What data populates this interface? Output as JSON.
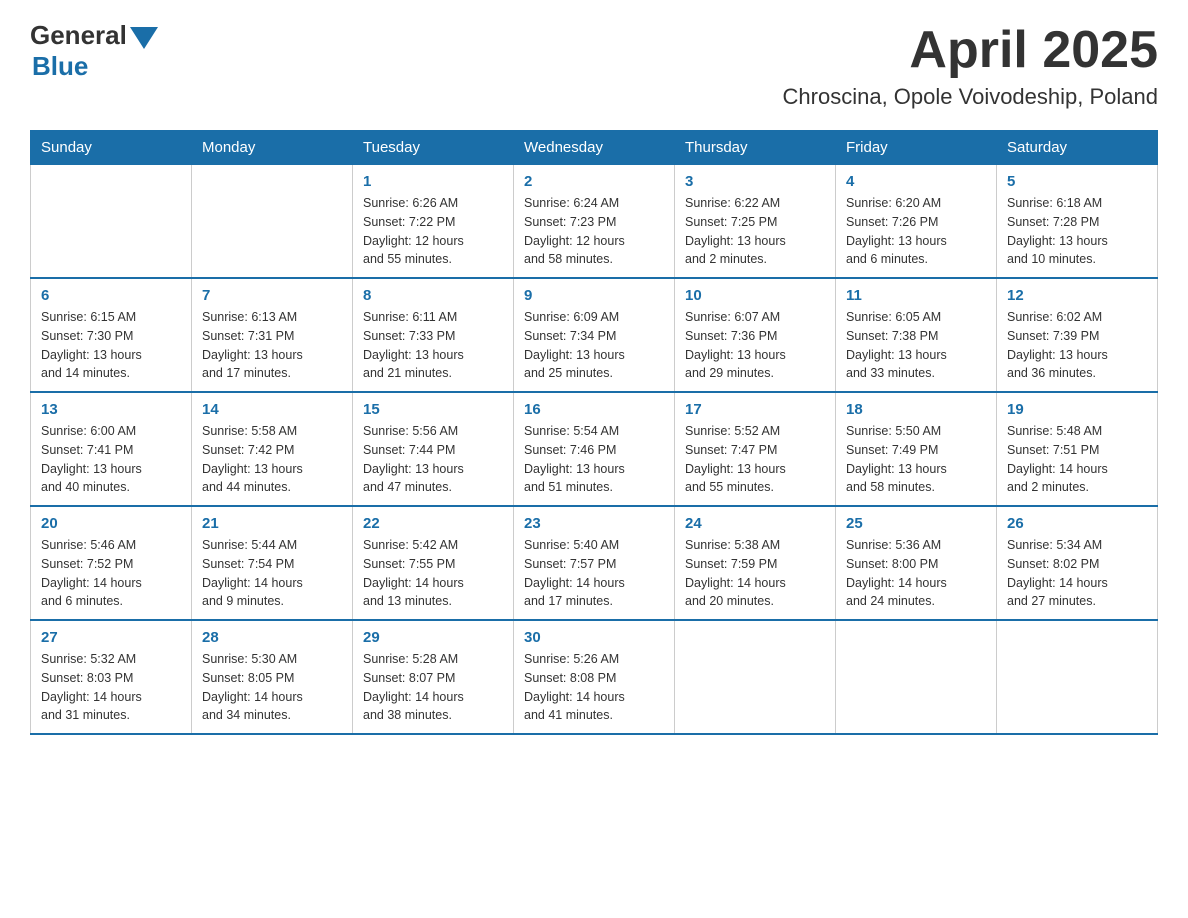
{
  "logo": {
    "general": "General",
    "blue": "Blue"
  },
  "header": {
    "month": "April 2025",
    "location": "Chroscina, Opole Voivodeship, Poland"
  },
  "weekdays": [
    "Sunday",
    "Monday",
    "Tuesday",
    "Wednesday",
    "Thursday",
    "Friday",
    "Saturday"
  ],
  "weeks": [
    [
      {
        "day": "",
        "sunrise": "",
        "sunset": "",
        "daylight": ""
      },
      {
        "day": "",
        "sunrise": "",
        "sunset": "",
        "daylight": ""
      },
      {
        "day": "1",
        "sunrise": "Sunrise: 6:26 AM",
        "sunset": "Sunset: 7:22 PM",
        "daylight": "Daylight: 12 hours and 55 minutes."
      },
      {
        "day": "2",
        "sunrise": "Sunrise: 6:24 AM",
        "sunset": "Sunset: 7:23 PM",
        "daylight": "Daylight: 12 hours and 58 minutes."
      },
      {
        "day": "3",
        "sunrise": "Sunrise: 6:22 AM",
        "sunset": "Sunset: 7:25 PM",
        "daylight": "Daylight: 13 hours and 2 minutes."
      },
      {
        "day": "4",
        "sunrise": "Sunrise: 6:20 AM",
        "sunset": "Sunset: 7:26 PM",
        "daylight": "Daylight: 13 hours and 6 minutes."
      },
      {
        "day": "5",
        "sunrise": "Sunrise: 6:18 AM",
        "sunset": "Sunset: 7:28 PM",
        "daylight": "Daylight: 13 hours and 10 minutes."
      }
    ],
    [
      {
        "day": "6",
        "sunrise": "Sunrise: 6:15 AM",
        "sunset": "Sunset: 7:30 PM",
        "daylight": "Daylight: 13 hours and 14 minutes."
      },
      {
        "day": "7",
        "sunrise": "Sunrise: 6:13 AM",
        "sunset": "Sunset: 7:31 PM",
        "daylight": "Daylight: 13 hours and 17 minutes."
      },
      {
        "day": "8",
        "sunrise": "Sunrise: 6:11 AM",
        "sunset": "Sunset: 7:33 PM",
        "daylight": "Daylight: 13 hours and 21 minutes."
      },
      {
        "day": "9",
        "sunrise": "Sunrise: 6:09 AM",
        "sunset": "Sunset: 7:34 PM",
        "daylight": "Daylight: 13 hours and 25 minutes."
      },
      {
        "day": "10",
        "sunrise": "Sunrise: 6:07 AM",
        "sunset": "Sunset: 7:36 PM",
        "daylight": "Daylight: 13 hours and 29 minutes."
      },
      {
        "day": "11",
        "sunrise": "Sunrise: 6:05 AM",
        "sunset": "Sunset: 7:38 PM",
        "daylight": "Daylight: 13 hours and 33 minutes."
      },
      {
        "day": "12",
        "sunrise": "Sunrise: 6:02 AM",
        "sunset": "Sunset: 7:39 PM",
        "daylight": "Daylight: 13 hours and 36 minutes."
      }
    ],
    [
      {
        "day": "13",
        "sunrise": "Sunrise: 6:00 AM",
        "sunset": "Sunset: 7:41 PM",
        "daylight": "Daylight: 13 hours and 40 minutes."
      },
      {
        "day": "14",
        "sunrise": "Sunrise: 5:58 AM",
        "sunset": "Sunset: 7:42 PM",
        "daylight": "Daylight: 13 hours and 44 minutes."
      },
      {
        "day": "15",
        "sunrise": "Sunrise: 5:56 AM",
        "sunset": "Sunset: 7:44 PM",
        "daylight": "Daylight: 13 hours and 47 minutes."
      },
      {
        "day": "16",
        "sunrise": "Sunrise: 5:54 AM",
        "sunset": "Sunset: 7:46 PM",
        "daylight": "Daylight: 13 hours and 51 minutes."
      },
      {
        "day": "17",
        "sunrise": "Sunrise: 5:52 AM",
        "sunset": "Sunset: 7:47 PM",
        "daylight": "Daylight: 13 hours and 55 minutes."
      },
      {
        "day": "18",
        "sunrise": "Sunrise: 5:50 AM",
        "sunset": "Sunset: 7:49 PM",
        "daylight": "Daylight: 13 hours and 58 minutes."
      },
      {
        "day": "19",
        "sunrise": "Sunrise: 5:48 AM",
        "sunset": "Sunset: 7:51 PM",
        "daylight": "Daylight: 14 hours and 2 minutes."
      }
    ],
    [
      {
        "day": "20",
        "sunrise": "Sunrise: 5:46 AM",
        "sunset": "Sunset: 7:52 PM",
        "daylight": "Daylight: 14 hours and 6 minutes."
      },
      {
        "day": "21",
        "sunrise": "Sunrise: 5:44 AM",
        "sunset": "Sunset: 7:54 PM",
        "daylight": "Daylight: 14 hours and 9 minutes."
      },
      {
        "day": "22",
        "sunrise": "Sunrise: 5:42 AM",
        "sunset": "Sunset: 7:55 PM",
        "daylight": "Daylight: 14 hours and 13 minutes."
      },
      {
        "day": "23",
        "sunrise": "Sunrise: 5:40 AM",
        "sunset": "Sunset: 7:57 PM",
        "daylight": "Daylight: 14 hours and 17 minutes."
      },
      {
        "day": "24",
        "sunrise": "Sunrise: 5:38 AM",
        "sunset": "Sunset: 7:59 PM",
        "daylight": "Daylight: 14 hours and 20 minutes."
      },
      {
        "day": "25",
        "sunrise": "Sunrise: 5:36 AM",
        "sunset": "Sunset: 8:00 PM",
        "daylight": "Daylight: 14 hours and 24 minutes."
      },
      {
        "day": "26",
        "sunrise": "Sunrise: 5:34 AM",
        "sunset": "Sunset: 8:02 PM",
        "daylight": "Daylight: 14 hours and 27 minutes."
      }
    ],
    [
      {
        "day": "27",
        "sunrise": "Sunrise: 5:32 AM",
        "sunset": "Sunset: 8:03 PM",
        "daylight": "Daylight: 14 hours and 31 minutes."
      },
      {
        "day": "28",
        "sunrise": "Sunrise: 5:30 AM",
        "sunset": "Sunset: 8:05 PM",
        "daylight": "Daylight: 14 hours and 34 minutes."
      },
      {
        "day": "29",
        "sunrise": "Sunrise: 5:28 AM",
        "sunset": "Sunset: 8:07 PM",
        "daylight": "Daylight: 14 hours and 38 minutes."
      },
      {
        "day": "30",
        "sunrise": "Sunrise: 5:26 AM",
        "sunset": "Sunset: 8:08 PM",
        "daylight": "Daylight: 14 hours and 41 minutes."
      },
      {
        "day": "",
        "sunrise": "",
        "sunset": "",
        "daylight": ""
      },
      {
        "day": "",
        "sunrise": "",
        "sunset": "",
        "daylight": ""
      },
      {
        "day": "",
        "sunrise": "",
        "sunset": "",
        "daylight": ""
      }
    ]
  ]
}
